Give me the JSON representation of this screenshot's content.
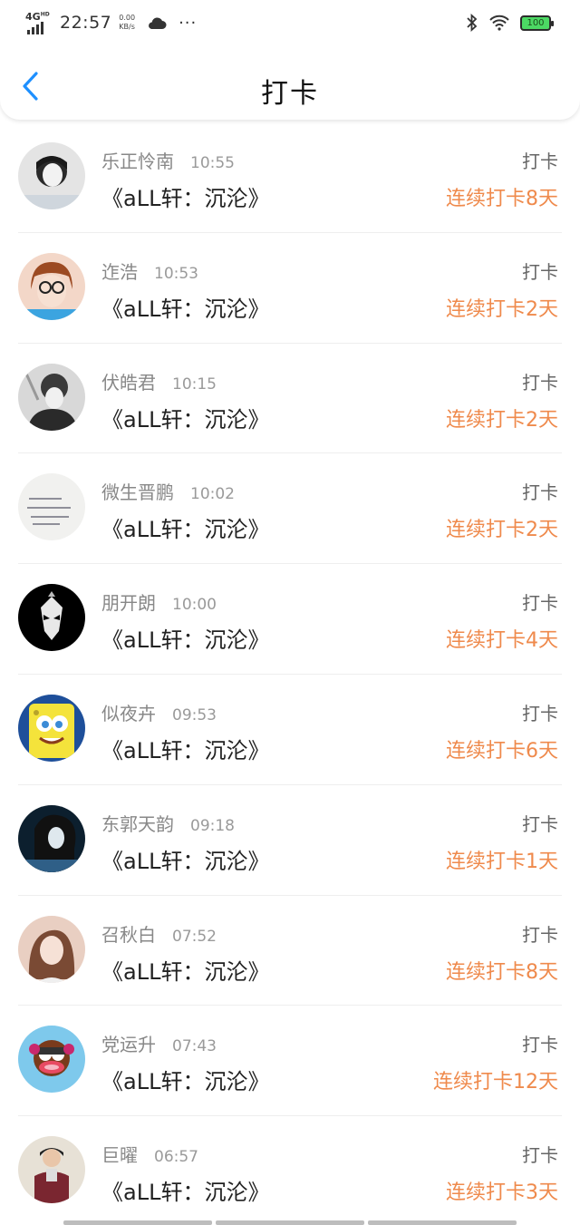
{
  "status_bar": {
    "network": "4G",
    "network_sup": "HD",
    "time": "22:57",
    "speed_value": "0.00",
    "speed_unit": "KB/s",
    "more": "···",
    "battery": "100"
  },
  "header": {
    "title": "打卡",
    "back_icon": "chevron-left-icon",
    "accent": "#1e90ff"
  },
  "colors": {
    "streak": "#ef8a4c"
  },
  "records": [
    {
      "name": "乐正怜南",
      "time": "10:55",
      "book": "《aLL轩：沉沦》",
      "action": "打卡",
      "streak": "连续打卡8天"
    },
    {
      "name": "迮浩",
      "time": "10:53",
      "book": "《aLL轩：沉沦》",
      "action": "打卡",
      "streak": "连续打卡2天"
    },
    {
      "name": "伏皓君",
      "time": "10:15",
      "book": "《aLL轩：沉沦》",
      "action": "打卡",
      "streak": "连续打卡2天"
    },
    {
      "name": "微生晋鹏",
      "time": "10:02",
      "book": "《aLL轩：沉沦》",
      "action": "打卡",
      "streak": "连续打卡2天"
    },
    {
      "name": "朋开朗",
      "time": "10:00",
      "book": "《aLL轩：沉沦》",
      "action": "打卡",
      "streak": "连续打卡4天"
    },
    {
      "name": "似夜卉",
      "time": "09:53",
      "book": "《aLL轩：沉沦》",
      "action": "打卡",
      "streak": "连续打卡6天"
    },
    {
      "name": "东郭天韵",
      "time": "09:18",
      "book": "《aLL轩：沉沦》",
      "action": "打卡",
      "streak": "连续打卡1天"
    },
    {
      "name": "召秋白",
      "time": "07:52",
      "book": "《aLL轩：沉沦》",
      "action": "打卡",
      "streak": "连续打卡8天"
    },
    {
      "name": "党运升",
      "time": "07:43",
      "book": "《aLL轩：沉沦》",
      "action": "打卡",
      "streak": "连续打卡12天"
    },
    {
      "name": "巨曜",
      "time": "06:57",
      "book": "《aLL轩：沉沦》",
      "action": "打卡",
      "streak": "连续打卡3天"
    }
  ]
}
